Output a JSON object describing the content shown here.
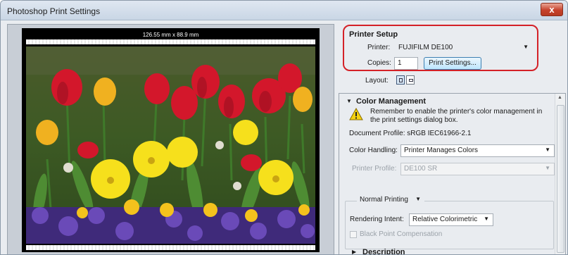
{
  "window": {
    "title": "Photoshop Print Settings",
    "close_label": "x"
  },
  "preview": {
    "dimensions": "126.55 mm x 88.9 mm"
  },
  "printer_setup": {
    "title": "Printer Setup",
    "printer_label": "Printer:",
    "printer_value": "FUJIFILM DE100",
    "copies_label": "Copies:",
    "copies_value": "1",
    "print_settings_label": "Print Settings...",
    "layout_label": "Layout:"
  },
  "color_management": {
    "title": "Color Management",
    "note": "Remember to enable the printer's color management in the print settings dialog box.",
    "document_profile": "Document Profile: sRGB IEC61966-2.1",
    "color_handling_label": "Color Handling:",
    "color_handling_value": "Printer Manages Colors",
    "printer_profile_label": "Printer Profile:",
    "printer_profile_value": "DE100 SR",
    "printing_mode_value": "Normal Printing",
    "rendering_intent_label": "Rendering Intent:",
    "rendering_intent_value": "Relative Colorimetric",
    "black_point_label": "Black Point Compensation"
  },
  "description": {
    "title": "Description"
  },
  "icons": {
    "close": "close-icon",
    "warning": "warning-icon",
    "expanded": "triangle-down-icon",
    "collapsed": "triangle-right-icon",
    "dropdown": "chevron-down-icon"
  },
  "colors": {
    "highlight_border": "#d42127",
    "button_blue": "#bee6fd",
    "window_bg": "#e9ecf0"
  }
}
